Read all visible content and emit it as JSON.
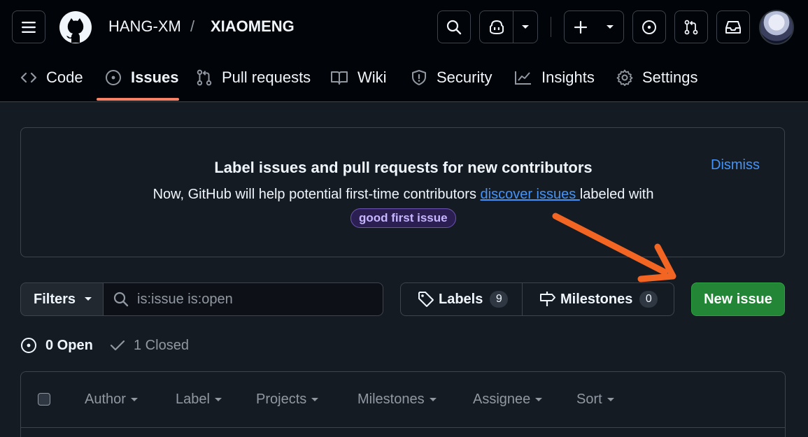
{
  "header": {
    "owner": "HANG-XM",
    "separator": "/",
    "repo": "XIAOMENG"
  },
  "icons": {
    "menu": "hamburger-icon",
    "logo": "github-mark-icon",
    "search": "search-icon",
    "copilot": "copilot-icon",
    "create": "plus-icon",
    "issues": "issue-opened-icon",
    "pulls": "git-pull-request-icon",
    "inbox": "inbox-icon"
  },
  "tabs": [
    {
      "label": "Code",
      "icon": "code-icon"
    },
    {
      "label": "Issues",
      "icon": "issue-opened-icon",
      "selected": true
    },
    {
      "label": "Pull requests",
      "icon": "git-pull-request-icon"
    },
    {
      "label": "Wiki",
      "icon": "book-icon"
    },
    {
      "label": "Security",
      "icon": "shield-icon"
    },
    {
      "label": "Insights",
      "icon": "graph-icon"
    },
    {
      "label": "Settings",
      "icon": "gear-icon"
    }
  ],
  "banner": {
    "title": "Label issues and pull requests for new contributors",
    "text_before": "Now, GitHub will help potential first-time contributors ",
    "link": "discover issues ",
    "text_after": "labeled with",
    "badge": "good first issue",
    "dismiss": "Dismiss"
  },
  "toolbar": {
    "filters_label": "Filters",
    "search_value": "is:issue is:open",
    "labels_label": "Labels",
    "labels_count": "9",
    "milestones_label": "Milestones",
    "milestones_count": "0",
    "new_issue_label": "New issue"
  },
  "states": {
    "open_label": "0 Open",
    "closed_label": "1 Closed"
  },
  "list_header": {
    "filters": [
      "Author",
      "Label",
      "Projects",
      "Milestones",
      "Assignee",
      "Sort"
    ]
  },
  "colors": {
    "accent_tab": "#f78166",
    "link": "#4493f8",
    "primary_button": "#238636",
    "annotation_arrow": "#f26522"
  }
}
